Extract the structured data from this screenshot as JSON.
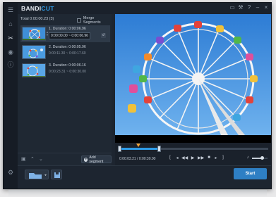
{
  "app": {
    "logo_main": "BANDI",
    "logo_accent": "CUT"
  },
  "segments_panel": {
    "total_label": "Total 0:00:00.23 (3)",
    "merge_label": "Merge Segments",
    "items": [
      {
        "index": "1.",
        "duration_label": "Duration: 0:00:06.96",
        "times": "0:00:00.00 ~ 0:00:06.96"
      },
      {
        "index": "2.",
        "duration_label": "Duration: 0:00:05.96",
        "times": "0:00:11.30 ~ 0:00:17.60"
      },
      {
        "index": "3.",
        "duration_label": "Duration: 0:00:06.16",
        "times": "0:00:23.31 ~ 0:00:30.00"
      }
    ],
    "add_segment_label": "Add segment"
  },
  "player": {
    "current_time": "0:00:03.21",
    "duration": "0:00:30.00",
    "time_sep": "/",
    "selection_fraction": 0.27,
    "playhead_fraction": 0.13,
    "volume_fraction": 0.65
  },
  "actions": {
    "start_label": "Start"
  },
  "icons": {
    "sidebar": [
      "menu-icon",
      "home-icon",
      "scissors-icon",
      "gamepad-icon",
      "info-icon",
      "gear-icon"
    ],
    "window": [
      "folder-icon",
      "wrench-icon",
      "help-icon",
      "minimize-icon",
      "close-icon"
    ]
  },
  "colors": {
    "accent": "#2e9ce8",
    "start_button": "#2e7fc4",
    "playhead": "#f0a33a"
  }
}
